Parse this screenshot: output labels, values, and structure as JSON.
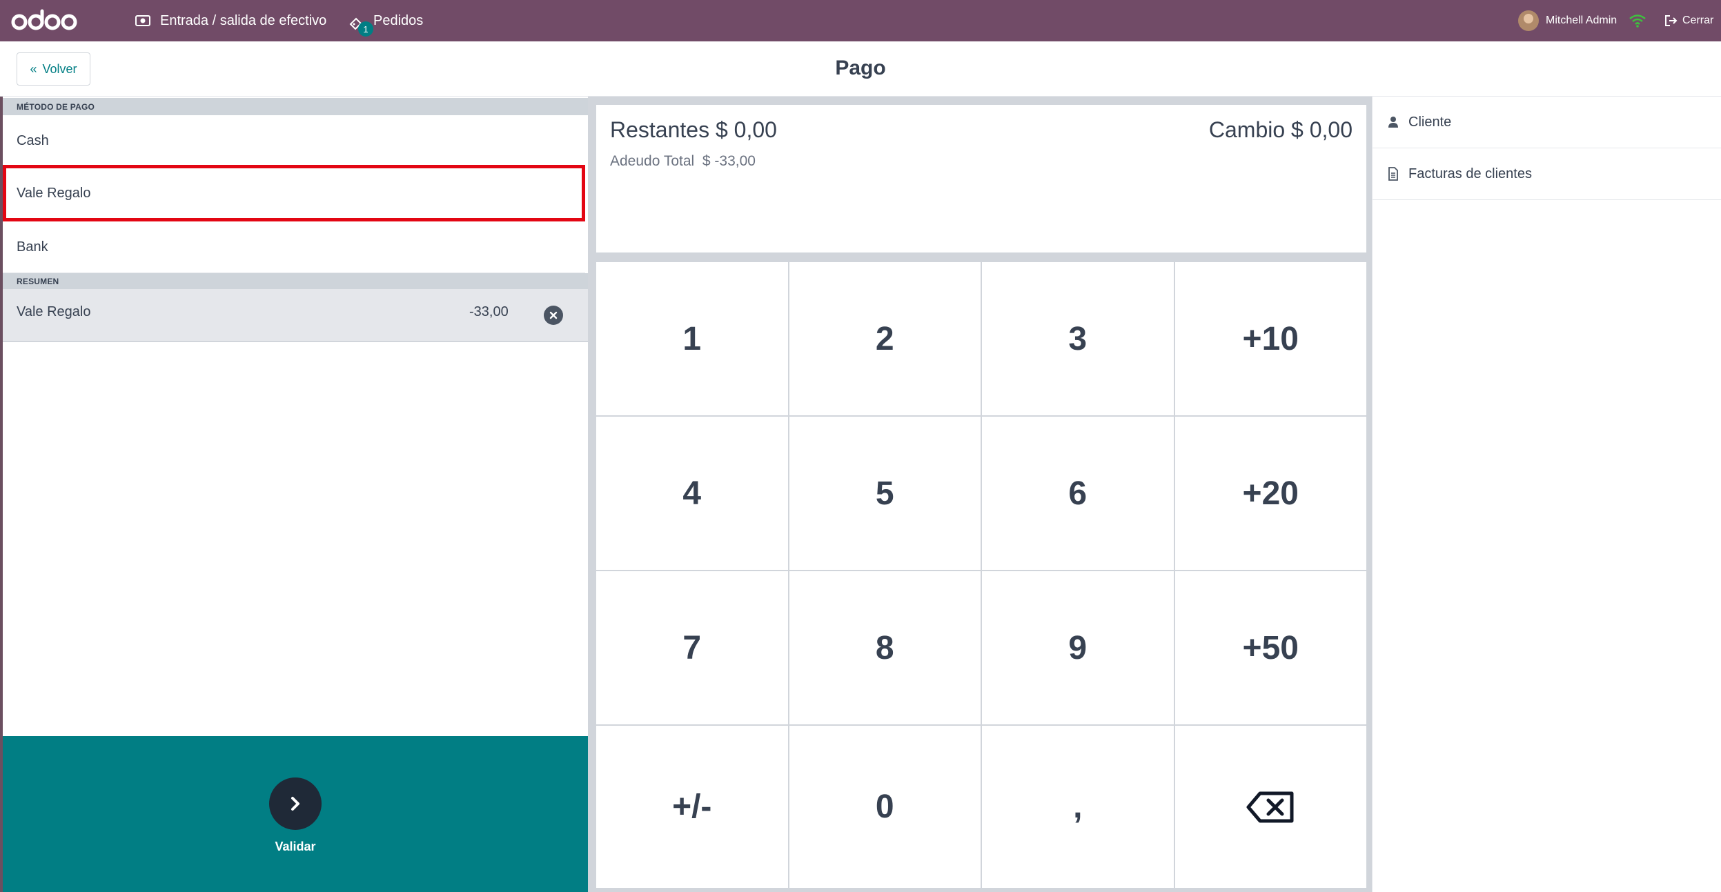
{
  "navbar": {
    "logo_text": "odoo",
    "cash_in_out": "Entrada / salida de efectivo",
    "orders": "Pedidos",
    "orders_badge": "1",
    "user": "Mitchell Admin",
    "close": "Cerrar"
  },
  "header": {
    "back": "Volver",
    "title": "Pago"
  },
  "payment_methods": {
    "heading": "MÉTODO DE PAGO",
    "items": [
      "Cash",
      "Vale Regalo",
      "Bank"
    ]
  },
  "summary": {
    "heading": "RESUMEN",
    "line": {
      "method": "Vale Regalo",
      "amount": "-33,00"
    }
  },
  "status": {
    "remaining_label": "Restantes",
    "remaining_value": "$ 0,00",
    "change_label": "Cambio",
    "change_value": "$ 0,00",
    "total_due_label": "Adeudo Total",
    "total_due_value": "$ -33,00"
  },
  "numpad": {
    "keys": [
      "1",
      "2",
      "3",
      "+10",
      "4",
      "5",
      "6",
      "+20",
      "7",
      "8",
      "9",
      "+50",
      "+/-",
      "0",
      ","
    ]
  },
  "validate": {
    "label": "Validar"
  },
  "right_panel": {
    "customer": "Cliente",
    "invoices": "Facturas de clientes"
  },
  "colors": {
    "navbar": "#714b67",
    "accent": "#017e84",
    "selected_border": "#e30613"
  }
}
